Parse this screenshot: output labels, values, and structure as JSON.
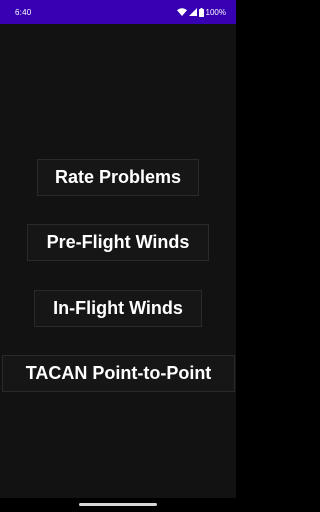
{
  "status_bar": {
    "time": "6:40",
    "battery": "100%",
    "icons": [
      "wifi-icon",
      "signal-icon",
      "battery-icon"
    ],
    "background_color": "#3700b3"
  },
  "menu": {
    "rate_problems": "Rate Problems",
    "pre_flight_winds": "Pre-Flight Winds",
    "in_flight_winds": "In-Flight Winds",
    "tacan_point_to_point": "TACAN Point-to-Point"
  },
  "theme": {
    "background": "#121212",
    "button_border": "#2a2a2a",
    "text": "#ffffff"
  }
}
